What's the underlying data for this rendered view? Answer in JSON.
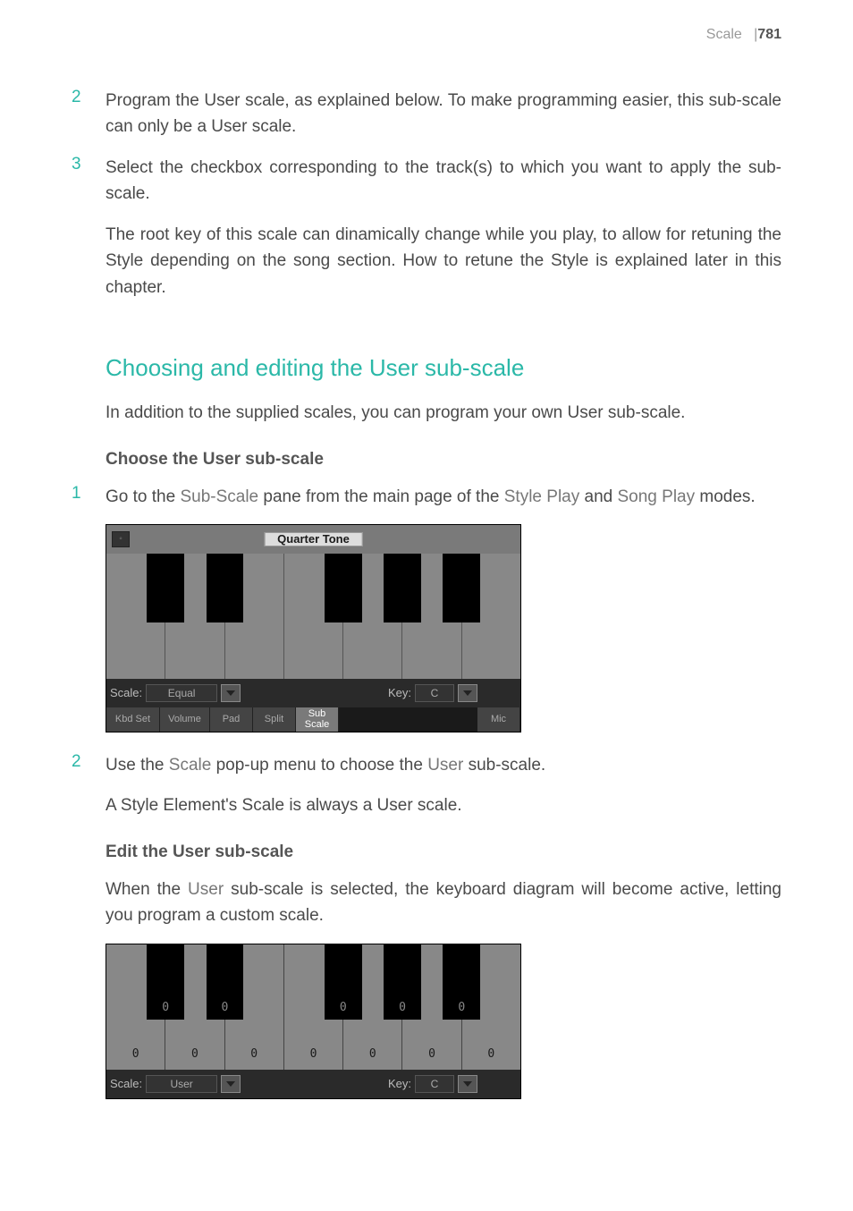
{
  "header": {
    "section": "Scale",
    "separator": "|",
    "page": "781"
  },
  "steps_intro": [
    {
      "num": "2",
      "text": "Program the User scale, as explained below. To make programming easier, this sub-scale can only be a User scale."
    },
    {
      "num": "3",
      "text": "Select the checkbox corresponding to the track(s) to which you want to apply the sub-scale."
    }
  ],
  "root_key_text": "The root key of this scale can dinamically change while you play, to allow for retuning the Style depending on the song section. How to retune the Style is explained later in this chapter.",
  "section_heading": "Choosing and editing the User sub-scale",
  "section_intro": "In addition to the supplied scales, you can program your own User sub-scale.",
  "sub_heading_1": "Choose the User sub-scale",
  "step_1": {
    "num": "1",
    "prefix": "Go to the ",
    "sub_scale": "Sub-Scale",
    "mid1": " pane from the main page of the ",
    "style_play": "Style Play",
    "mid2": " and ",
    "song_play": "Song Play",
    "suffix": " modes."
  },
  "panel1": {
    "quarter_tone": "Quarter Tone",
    "scale_label": "Scale:",
    "scale_value": "Equal",
    "key_label": "Key:",
    "key_value": "C",
    "tabs": {
      "kbd_set": "Kbd Set",
      "volume": "Volume",
      "pad": "Pad",
      "split": "Split",
      "sub_scale": "Sub Scale",
      "mic": "Mic"
    }
  },
  "step_2": {
    "num": "2",
    "prefix": "Use the ",
    "scale": "Scale",
    "mid": " pop-up menu to choose the ",
    "user": "User",
    "suffix": " sub-scale."
  },
  "step_2_note": "A Style Element's Scale is always a User scale.",
  "sub_heading_2": "Edit the User sub-scale",
  "edit_text": {
    "prefix": "When the ",
    "user": "User",
    "suffix": " sub-scale is selected, the keyboard diagram will become active, letting you program a custom scale."
  },
  "panel2": {
    "white_values": [
      "0",
      "0",
      "0",
      "0",
      "0",
      "0",
      "0"
    ],
    "black_values": [
      "0",
      "0",
      "0",
      "0",
      "0"
    ],
    "scale_label": "Scale:",
    "scale_value": "User",
    "key_label": "Key:",
    "key_value": "C"
  }
}
